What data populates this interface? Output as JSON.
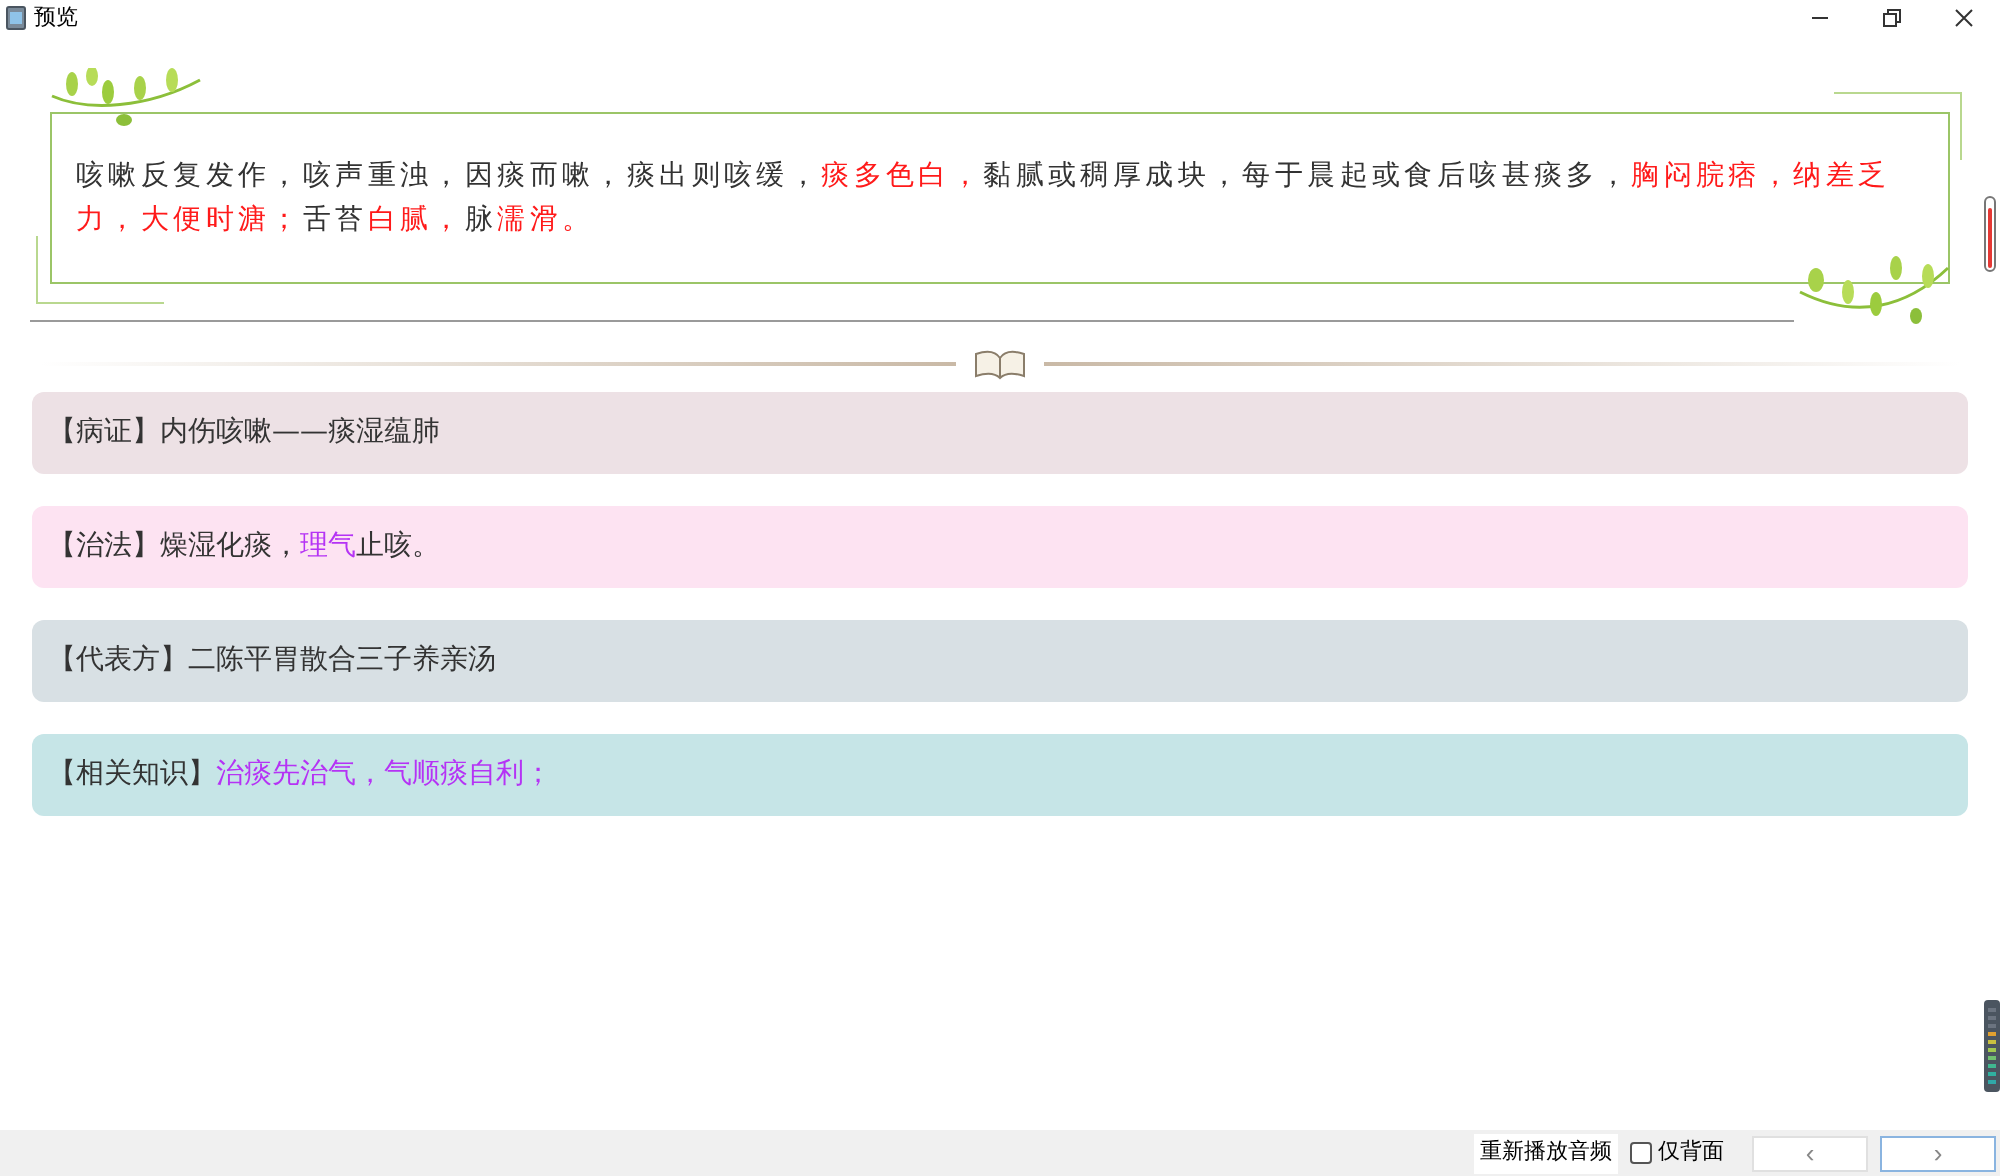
{
  "window": {
    "title": "预览"
  },
  "symptoms": [
    {
      "text": "咳嗽反复发作，咳声重浊，因痰而嗽，痰出则咳缓，",
      "highlight": false
    },
    {
      "text": "痰多色白，",
      "highlight": true
    },
    {
      "text": "黏腻或稠厚成块，每于晨起或食后咳甚痰多，",
      "highlight": false
    },
    {
      "text": "胸闷脘痞，纳差乏力，大便时溏；",
      "highlight": true
    },
    {
      "text": "舌苔",
      "highlight": false
    },
    {
      "text": "白腻，",
      "highlight": true
    },
    {
      "text": "脉",
      "highlight": false
    },
    {
      "text": "濡滑。",
      "highlight": true
    }
  ],
  "cards": [
    {
      "label": "【病证】",
      "color": "#ede1e5",
      "segments": [
        {
          "text": "内伤咳嗽——痰湿蕴肺",
          "highlight": false
        }
      ]
    },
    {
      "label": "【治法】",
      "color": "#fde3f2",
      "segments": [
        {
          "text": "燥湿化痰，",
          "highlight": false
        },
        {
          "text": "理气",
          "highlight": true
        },
        {
          "text": "止咳。",
          "highlight": false
        }
      ]
    },
    {
      "label": "【代表方】",
      "color": "#d8e0e4",
      "segments": [
        {
          "text": "二陈平胃散合三子养亲汤",
          "highlight": false
        }
      ]
    },
    {
      "label": "【相关知识】",
      "color": "#c6e5e7",
      "segments": [
        {
          "text": "治痰先治气，气顺痰自利；",
          "highlight": true
        }
      ]
    }
  ],
  "bottom_bar": {
    "replay_button": "重新播放音频",
    "back_only": {
      "label": "仅背面",
      "checked": false
    },
    "prev_button": "‹",
    "next_button": "›"
  }
}
